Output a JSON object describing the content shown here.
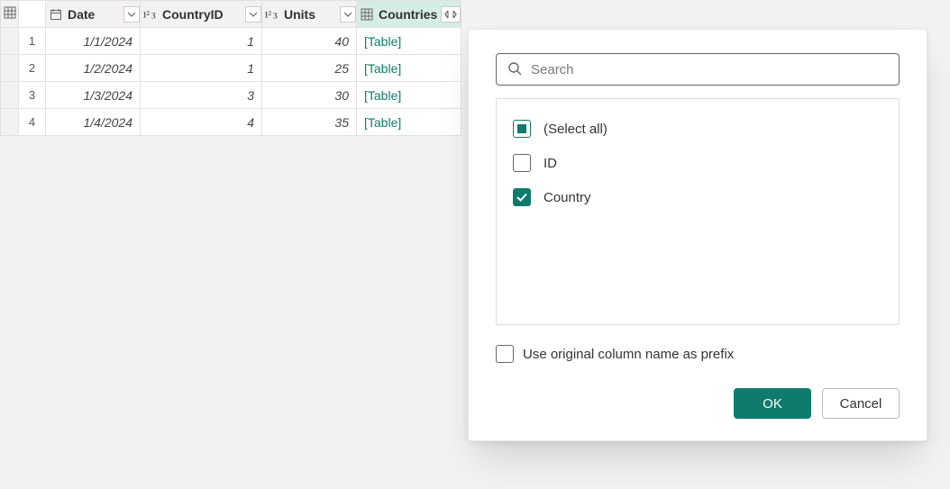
{
  "table": {
    "columns": [
      {
        "label": "Date",
        "type": "date"
      },
      {
        "label": "CountryID",
        "type": "number"
      },
      {
        "label": "Units",
        "type": "number"
      },
      {
        "label": "Countries",
        "type": "table",
        "selected": true,
        "expandable": true
      }
    ],
    "rows": [
      {
        "n": "1",
        "date": "1/1/2024",
        "countryid": "1",
        "units": "40",
        "countries": "[Table]"
      },
      {
        "n": "2",
        "date": "1/2/2024",
        "countryid": "1",
        "units": "25",
        "countries": "[Table]"
      },
      {
        "n": "3",
        "date": "1/3/2024",
        "countryid": "3",
        "units": "30",
        "countries": "[Table]"
      },
      {
        "n": "4",
        "date": "1/4/2024",
        "countryid": "4",
        "units": "35",
        "countries": "[Table]"
      }
    ]
  },
  "popup": {
    "search_placeholder": "Search",
    "options": [
      {
        "label": "(Select all)",
        "state": "indeterminate"
      },
      {
        "label": "ID",
        "state": "unchecked"
      },
      {
        "label": "Country",
        "state": "checked"
      }
    ],
    "prefix_label": "Use original column name as prefix",
    "prefix_checked": false,
    "ok_label": "OK",
    "cancel_label": "Cancel"
  }
}
